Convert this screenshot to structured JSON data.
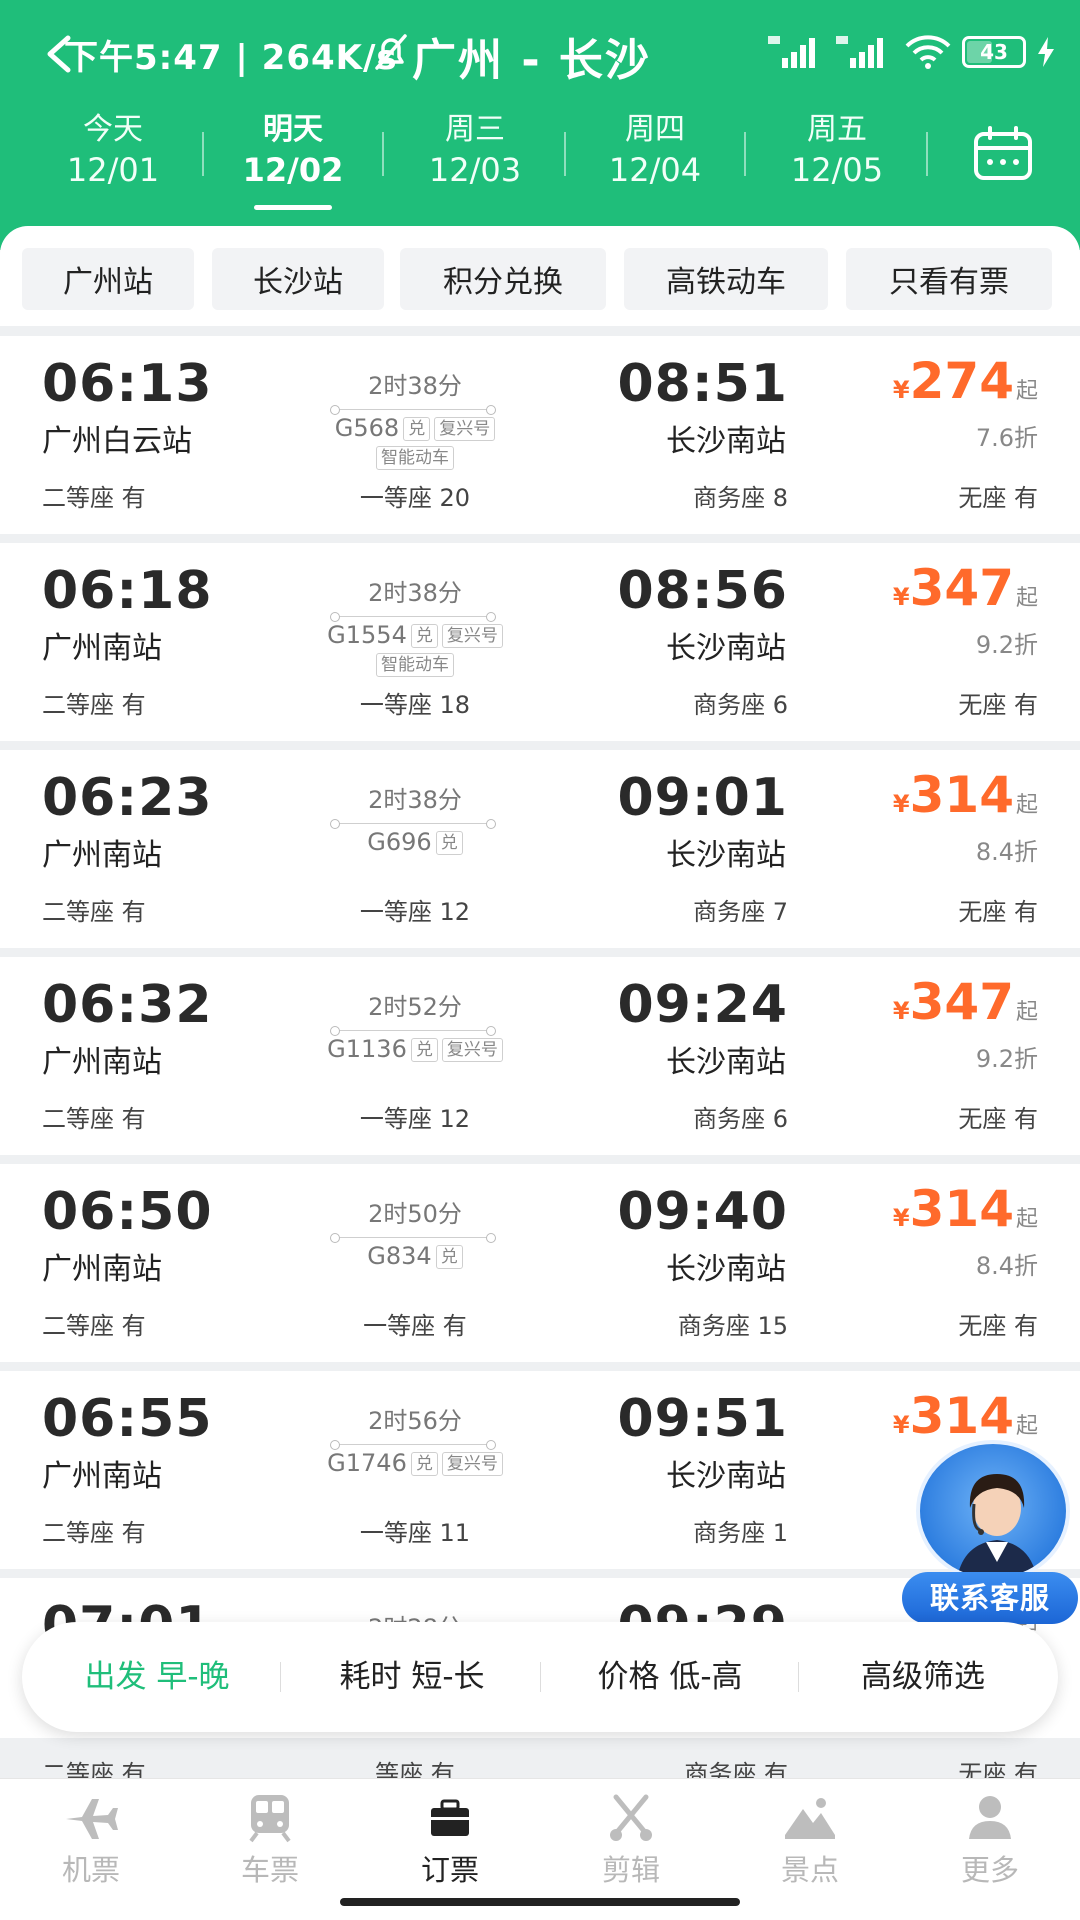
{
  "status_bar": {
    "time_speed": "下午5:47 | 264K/s",
    "battery": "43"
  },
  "title": "广州 - 长沙",
  "date_tabs": [
    {
      "name": "今天",
      "date": "12/01"
    },
    {
      "name": "明天",
      "date": "12/02",
      "active": true
    },
    {
      "name": "周三",
      "date": "12/03"
    },
    {
      "name": "周四",
      "date": "12/04"
    },
    {
      "name": "周五",
      "date": "12/05"
    }
  ],
  "filters": [
    "广州站",
    "长沙站",
    "积分兑换",
    "高铁动车",
    "只看有票"
  ],
  "trains": [
    {
      "dep_time": "06:13",
      "dep_station": "广州白云站",
      "duration": "2时38分",
      "number": "G568",
      "tag1": "兑",
      "tag2": "复兴号",
      "tag3": "智能动车",
      "arr_time": "08:51",
      "arr_station": "长沙南站",
      "yen": "¥",
      "price": "274",
      "qi": "起",
      "discount": "7.6折",
      "seat1": "二等座 有",
      "seat2": "一等座 20",
      "seat3": "商务座 8",
      "seat4": "无座 有"
    },
    {
      "dep_time": "06:18",
      "dep_station": "广州南站",
      "duration": "2时38分",
      "number": "G1554",
      "tag1": "兑",
      "tag2": "复兴号",
      "tag3": "智能动车",
      "arr_time": "08:56",
      "arr_station": "长沙南站",
      "yen": "¥",
      "price": "347",
      "qi": "起",
      "discount": "9.2折",
      "seat1": "二等座 有",
      "seat2": "一等座 18",
      "seat3": "商务座 6",
      "seat4": "无座 有"
    },
    {
      "dep_time": "06:23",
      "dep_station": "广州南站",
      "duration": "2时38分",
      "number": "G696",
      "tag1": "兑",
      "arr_time": "09:01",
      "arr_station": "长沙南站",
      "yen": "¥",
      "price": "314",
      "qi": "起",
      "discount": "8.4折",
      "seat1": "二等座 有",
      "seat2": "一等座 12",
      "seat3": "商务座 7",
      "seat4": "无座 有"
    },
    {
      "dep_time": "06:32",
      "dep_station": "广州南站",
      "duration": "2时52分",
      "number": "G1136",
      "tag1": "兑",
      "tag2": "复兴号",
      "arr_time": "09:24",
      "arr_station": "长沙南站",
      "yen": "¥",
      "price": "347",
      "qi": "起",
      "discount": "9.2折",
      "seat1": "二等座 有",
      "seat2": "一等座 12",
      "seat3": "商务座 6",
      "seat4": "无座 有"
    },
    {
      "dep_time": "06:50",
      "dep_station": "广州南站",
      "duration": "2时50分",
      "number": "G834",
      "tag1": "兑",
      "arr_time": "09:40",
      "arr_station": "长沙南站",
      "yen": "¥",
      "price": "314",
      "qi": "起",
      "discount": "8.4折",
      "seat1": "二等座 有",
      "seat2": "一等座 有",
      "seat3": "商务座 15",
      "seat4": "无座 有"
    },
    {
      "dep_time": "06:55",
      "dep_station": "广州南站",
      "duration": "2时56分",
      "number": "G1746",
      "tag1": "兑",
      "tag2": "复兴号",
      "arr_time": "09:51",
      "arr_station": "长沙南站",
      "yen": "¥",
      "price": "314",
      "qi": "起",
      "seat1": "二等座 有",
      "seat2": "一等座 11",
      "seat3": "商务座 1"
    },
    {
      "dep_time": "07:01",
      "duration": "2时28分",
      "arr_time": "09:29",
      "yen": "¥",
      "price": "314",
      "qi": "起",
      "seat1": "二等座 有",
      "seat2": "等座 有",
      "seat3": "商务座 有",
      "seat4": "无座 有"
    }
  ],
  "sort_bar": [
    "出发 早-晚",
    "耗时 短-长",
    "价格 低-高",
    "高级筛选"
  ],
  "customer_service": "联系客服",
  "bottom_nav": [
    {
      "label": "机票",
      "icon": "plane-icon"
    },
    {
      "label": "车票",
      "icon": "train-icon"
    },
    {
      "label": "订票",
      "icon": "briefcase-icon",
      "active": true
    },
    {
      "label": "剪辑",
      "icon": "scissors-icon"
    },
    {
      "label": "景点",
      "icon": "landscape-icon"
    },
    {
      "label": "更多",
      "icon": "person-icon"
    }
  ],
  "colors": {
    "brand_green": "#1fbe7a",
    "price_orange": "#ff6a2b",
    "service_blue": "#2f7fe0"
  }
}
